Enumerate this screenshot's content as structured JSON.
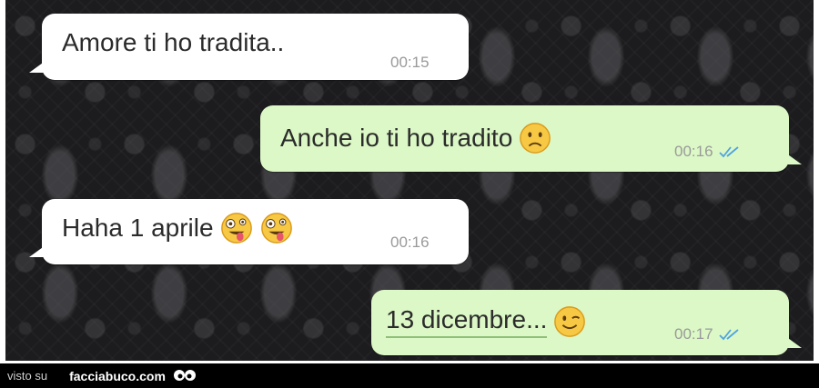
{
  "messages": [
    {
      "text": "Amore ti ho tradita..",
      "time": "00:15",
      "direction": "incoming"
    },
    {
      "text": "Anche io ti ho tradito",
      "time": "00:16",
      "direction": "outgoing",
      "emoji": "sad-face",
      "status": "read"
    },
    {
      "text": "Haha 1 aprile",
      "time": "00:16",
      "direction": "incoming",
      "emoji": "zany-face"
    },
    {
      "text": "13 dicembre...",
      "time": "00:17",
      "direction": "outgoing",
      "emoji": "winking-face",
      "status": "read"
    }
  ],
  "footer": {
    "visto_su": "visto su",
    "site": "facciabuco.com"
  },
  "colors": {
    "incoming": "#ffffff",
    "outgoing": "#dcf8c6",
    "read_ticks": "#4fa3e0",
    "background": "#1c1c1e"
  }
}
